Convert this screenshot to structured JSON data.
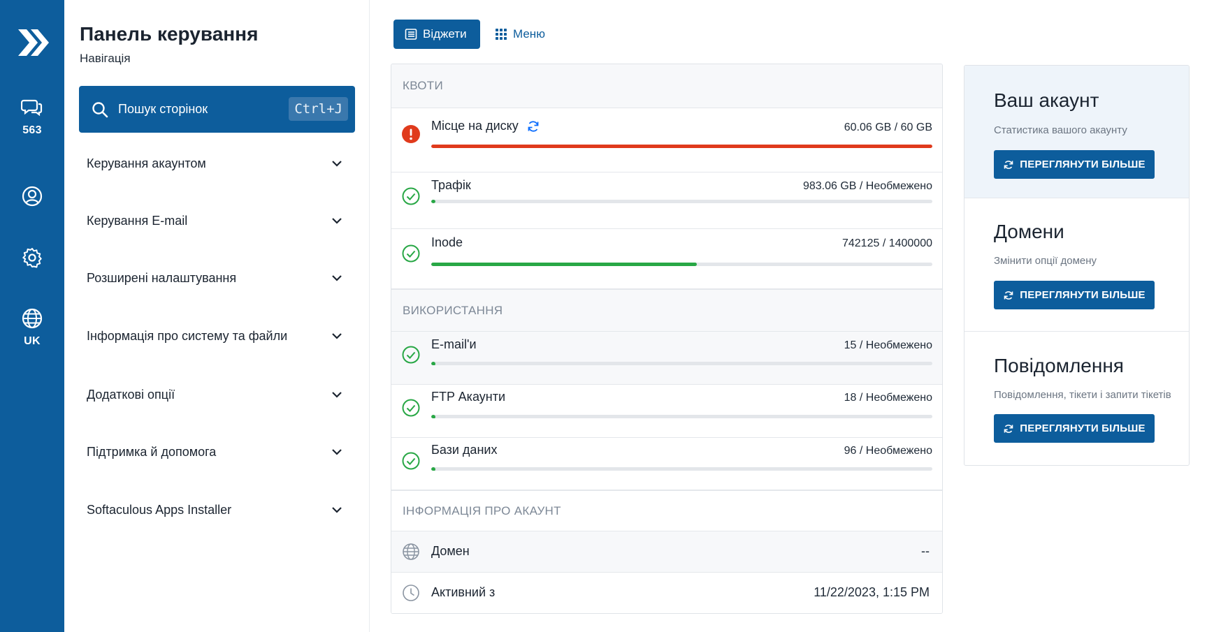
{
  "rail": {
    "messages_count": "563",
    "language": "UK"
  },
  "sidebar": {
    "title": "Панель керування",
    "subtitle": "Навігація",
    "search": {
      "label": "Пошук сторінок",
      "shortcut": "Ctrl+J"
    },
    "items": [
      {
        "label": "Керування акаунтом"
      },
      {
        "label": "Керування E-mail"
      },
      {
        "label": "Розширені налаштування"
      },
      {
        "label": "Інформація про систему та файли"
      },
      {
        "label": "Додаткові опції"
      },
      {
        "label": "Підтримка й допомога"
      },
      {
        "label": "Softaculous Apps Installer"
      }
    ]
  },
  "view_toggle": {
    "widgets": "Віджети",
    "menu": "Меню"
  },
  "quotas": {
    "title": "КВОТИ",
    "rows": [
      {
        "label": "Місце на диску",
        "value": "60.06 GB / 60 GB",
        "status": "error",
        "fraction": 1.0,
        "color": "#e03a1c"
      },
      {
        "label": "Трафік",
        "value": "983.06 GB / Необмежено",
        "status": "ok",
        "fraction": 0.0,
        "color": "#28a745"
      },
      {
        "label": "Inode",
        "value": "742125 / 1400000",
        "status": "ok",
        "fraction": 0.53,
        "color": "#28a745"
      }
    ]
  },
  "usage": {
    "title": "ВИКОРИСТАННЯ",
    "rows": [
      {
        "label": "E-mail'и",
        "value": "15 / Необмежено",
        "status": "ok",
        "fraction": 0.0
      },
      {
        "label": "FTP Акаунти",
        "value": "18 / Необмежено",
        "status": "ok",
        "fraction": 0.0
      },
      {
        "label": "Бази даних",
        "value": "96 / Необмежено",
        "status": "ok",
        "fraction": 0.0
      }
    ]
  },
  "account_info": {
    "title": "ІНФОРМАЦІЯ ПРО АКАУНТ",
    "domain_label": "Домен",
    "domain_value": "--",
    "active_label": "Активний з",
    "active_value": "11/22/2023, 1:15 PM"
  },
  "cards": [
    {
      "title": "Ваш акаунт",
      "subtitle": "Статистика вашого акаунту",
      "button": "ПЕРЕГЛЯНУТИ БІЛЬШЕ"
    },
    {
      "title": "Домени",
      "subtitle": "Змінити опції домену",
      "button": "ПЕРЕГЛЯНУТИ БІЛЬШЕ"
    },
    {
      "title": "Повідомлення",
      "subtitle": "Повідомлення, тікети і запити тікетів",
      "button": "ПЕРЕГЛЯНУТИ БІЛЬШЕ"
    }
  ],
  "colors": {
    "brand": "#0d5d9c",
    "error": "#e03a1c",
    "ok": "#28a745"
  }
}
